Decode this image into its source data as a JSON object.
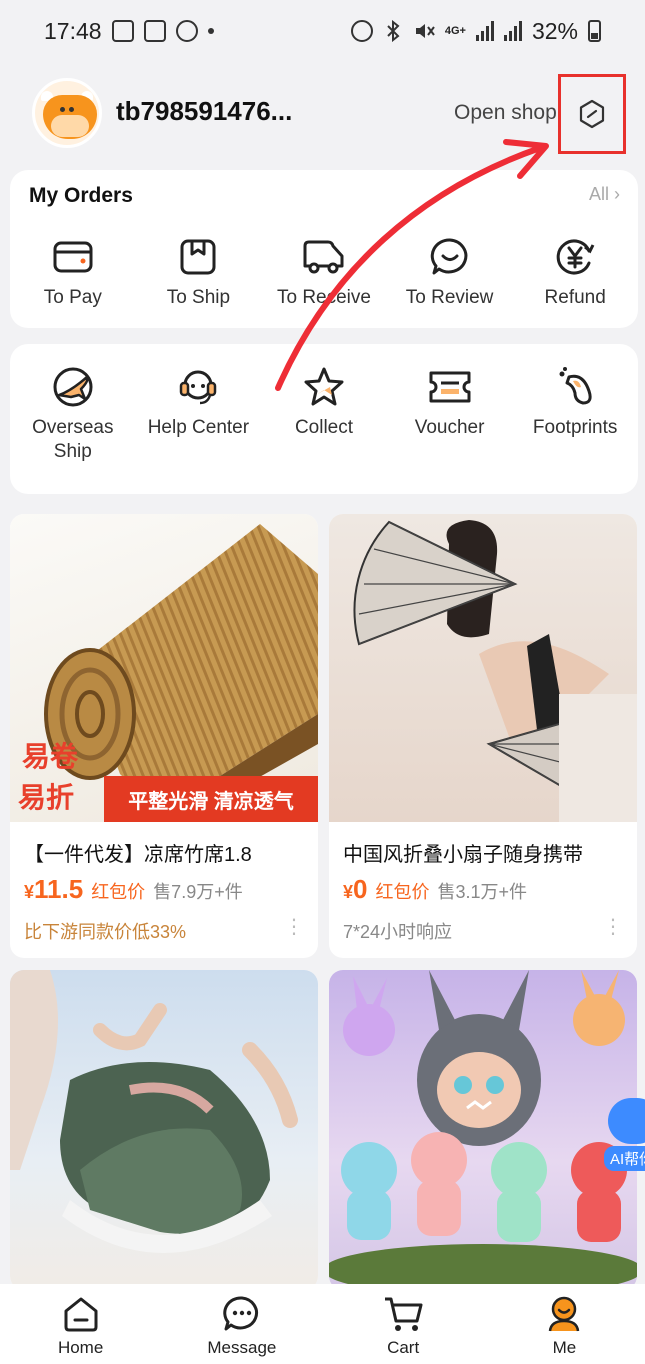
{
  "status_bar": {
    "time": "17:48",
    "network": "4G+",
    "battery": "32%"
  },
  "header": {
    "username": "tb798591476...",
    "open_shop_label": "Open shop"
  },
  "orders": {
    "title": "My Orders",
    "all_label": "All",
    "items": [
      {
        "label": "To Pay",
        "icon": "wallet-icon"
      },
      {
        "label": "To Ship",
        "icon": "package-icon"
      },
      {
        "label": "To Receive",
        "icon": "truck-icon"
      },
      {
        "label": "To Review",
        "icon": "chat-smile-icon"
      },
      {
        "label": "Refund",
        "icon": "yen-refund-icon"
      }
    ]
  },
  "tools": {
    "items": [
      {
        "label_line1": "Overseas",
        "label_line2": "Ship",
        "icon": "plane-icon"
      },
      {
        "label_line1": "Help Center",
        "label_line2": "",
        "icon": "headset-icon"
      },
      {
        "label_line1": "Collect",
        "label_line2": "",
        "icon": "star-icon"
      },
      {
        "label_line1": "Voucher",
        "label_line2": "",
        "icon": "ticket-icon"
      },
      {
        "label_line1": "Footprints",
        "label_line2": "",
        "icon": "footprint-icon"
      }
    ]
  },
  "products": [
    {
      "title": "【一件代发】凉席竹席1.8",
      "currency": "¥",
      "price": "11.5",
      "price_tag": "红包价",
      "sold": "售7.9万+件",
      "note": "比下游同款价低33%",
      "image_badge_top": "易卷",
      "image_badge_bottom": "易折",
      "image_strip": "平整光滑 清凉透气"
    },
    {
      "title": "中国风折叠小扇子随身携带",
      "currency": "¥",
      "price": "0",
      "price_tag": "红包价",
      "sold": "售3.1万+件",
      "note": "7*24小时响应"
    },
    {
      "title": "",
      "image": "knit-shoes"
    },
    {
      "title": "",
      "image": "labubu-toys"
    }
  ],
  "ai_help_label": "AI帮你",
  "bottom_nav": [
    {
      "label": "Home",
      "icon": "home-icon"
    },
    {
      "label": "Message",
      "icon": "message-icon"
    },
    {
      "label": "Cart",
      "icon": "cart-icon"
    },
    {
      "label": "Me",
      "icon": "me-icon",
      "active": true
    }
  ],
  "colors": {
    "accent": "#f7651e",
    "highlight_red": "#e8312c",
    "background": "#f2f2f4"
  }
}
